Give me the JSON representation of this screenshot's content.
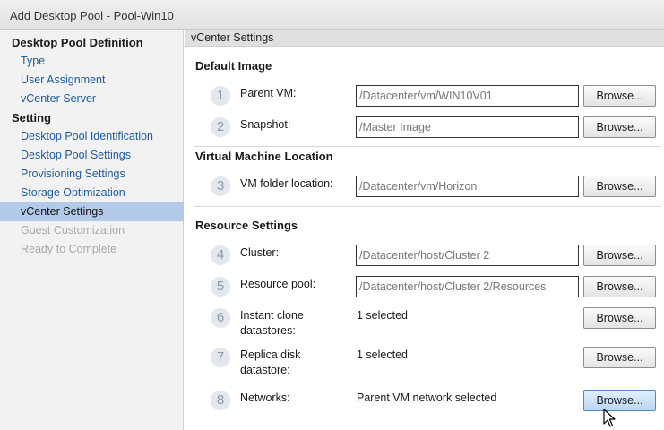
{
  "window": {
    "title": "Add Desktop Pool - Pool-Win10"
  },
  "sidebar": {
    "groups": [
      {
        "label": "Desktop Pool Definition",
        "items": [
          {
            "label": "Type"
          },
          {
            "label": "User Assignment"
          },
          {
            "label": "vCenter Server"
          }
        ]
      },
      {
        "label": "Setting",
        "items": [
          {
            "label": "Desktop Pool Identification"
          },
          {
            "label": "Desktop Pool Settings"
          },
          {
            "label": "Provisioning Settings"
          },
          {
            "label": "Storage Optimization"
          },
          {
            "label": "vCenter Settings",
            "state": "active"
          },
          {
            "label": "Guest Customization",
            "state": "disabled"
          },
          {
            "label": "Ready to Complete",
            "state": "disabled"
          }
        ]
      }
    ]
  },
  "content": {
    "header": "vCenter Settings",
    "sections": [
      {
        "title": "Default Image"
      },
      {
        "title": "Virtual Machine Location"
      },
      {
        "title": "Resource Settings"
      }
    ],
    "fields": [
      {
        "step": "1",
        "label": "Parent VM:",
        "value": "/Datacenter/vm/WIN10V01",
        "button": "Browse..."
      },
      {
        "step": "2",
        "label": "Snapshot:",
        "value": "/Master Image",
        "button": "Browse..."
      },
      {
        "step": "3",
        "label": "VM folder location:",
        "value": "/Datacenter/vm/Horizon",
        "button": "Browse..."
      },
      {
        "step": "4",
        "label": "Cluster:",
        "value": "/Datacenter/host/Cluster 2",
        "button": "Browse..."
      },
      {
        "step": "5",
        "label": "Resource pool:",
        "value": "/Datacenter/host/Cluster 2/Resources",
        "button": "Browse..."
      },
      {
        "step": "6",
        "label_line1": "Instant clone",
        "label_line2": "datastores:",
        "value": "1 selected",
        "button": "Browse..."
      },
      {
        "step": "7",
        "label_line1": "Replica disk",
        "label_line2": "datastore:",
        "value": "1 selected",
        "button": "Browse..."
      },
      {
        "step": "8",
        "label": "Networks:",
        "value": "Parent VM network selected",
        "button": "Browse..."
      }
    ]
  },
  "icons": {
    "cursor": "mouse-pointer-icon"
  },
  "colors": {
    "link": "#1f5a9e",
    "active_bg": "#b3c9e8",
    "disabled": "#a9a9a9",
    "step_circle": "#e3e8ee"
  }
}
